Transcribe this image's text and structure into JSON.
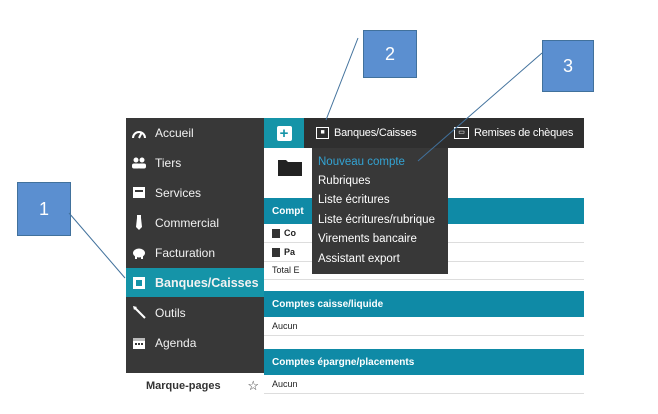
{
  "callouts": [
    "1",
    "2",
    "3"
  ],
  "sidebar": {
    "items": [
      {
        "label": "Accueil",
        "icon": "gauge-icon"
      },
      {
        "label": "Tiers",
        "icon": "users-icon"
      },
      {
        "label": "Services",
        "icon": "box-icon"
      },
      {
        "label": "Commercial",
        "icon": "tie-icon"
      },
      {
        "label": "Facturation",
        "icon": "piggy-bank-icon"
      },
      {
        "label": "Banques/Caisses",
        "icon": "bank-icon",
        "active": true
      },
      {
        "label": "Outils",
        "icon": "wand-icon"
      },
      {
        "label": "Agenda",
        "icon": "calendar-icon"
      }
    ],
    "bookmarks_label": "Marque-pages"
  },
  "topbar": {
    "banques_label": "Banques/Caisses",
    "remises_label": "Remises de chèques"
  },
  "dropdown": {
    "items": [
      {
        "label": "Nouveau compte",
        "highlighted": true
      },
      {
        "label": "Rubriques"
      },
      {
        "label": "Liste écritures"
      },
      {
        "label": "Liste écritures/rubrique"
      },
      {
        "label": "Virements bancaire"
      },
      {
        "label": "Assistant export"
      }
    ]
  },
  "content": {
    "section1_header": "Compt",
    "section1_rows": [
      "Co",
      "Pa",
      "Total E"
    ],
    "section2_header": "Comptes caisse/liquide",
    "section2_row": "Aucun",
    "section3_header": "Comptes épargne/placements",
    "section3_row": "Aucun"
  },
  "colors": {
    "accent": "#1594a8",
    "sidebar_bg": "#383838",
    "topbar_bg": "#2f2f2f",
    "section_header": "#0f8aa6",
    "dropdown_highlight": "#33a3d3",
    "callout_fill": "#5b8fd0"
  }
}
